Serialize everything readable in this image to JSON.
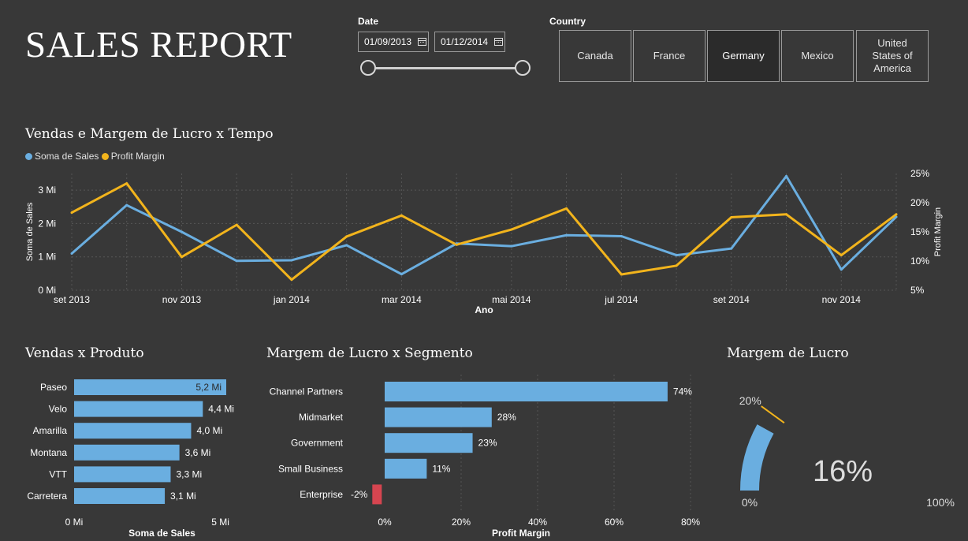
{
  "header": {
    "title": "SALES REPORT"
  },
  "date_filter": {
    "label": "Date",
    "start": "01/09/2013",
    "end": "01/12/2014",
    "range_fraction": [
      0,
      1
    ]
  },
  "country_filter": {
    "label": "Country",
    "options": [
      "Canada",
      "France",
      "Germany",
      "Mexico",
      "United States of America"
    ],
    "selected": "Germany"
  },
  "colors": {
    "background": "#383838",
    "sales": "#6aaee0",
    "margin": "#f2b41c",
    "negative": "#d64550",
    "grid": "#555555"
  },
  "chart_data": [
    {
      "type": "line",
      "title": "Vendas e Margem de Lucro x Tempo",
      "xlabel": "Ano",
      "ylabel": "Soma de Sales",
      "y2label": "Profit Margin",
      "legend": [
        "Soma de  Sales",
        "Profit Margin"
      ],
      "legend_position": "top-left",
      "x": [
        "set 2013",
        "out 2013",
        "nov 2013",
        "dez 2013",
        "jan 2014",
        "fev 2014",
        "mar 2014",
        "abr 2014",
        "mai 2014",
        "jun 2014",
        "jul 2014",
        "ago 2014",
        "set 2014",
        "out 2014",
        "nov 2014",
        "dez 2014"
      ],
      "x_ticks": [
        "set 2013",
        "nov 2013",
        "jan 2014",
        "mar 2014",
        "mai 2014",
        "jul 2014",
        "set 2014",
        "nov 2014"
      ],
      "y_ticks": [
        "0 Mi",
        "1 Mi",
        "2 Mi",
        "3 Mi"
      ],
      "y2_ticks": [
        "5%",
        "10%",
        "15%",
        "20%",
        "25%"
      ],
      "ylim": [
        0,
        3.5
      ],
      "y2lim": [
        5,
        25
      ],
      "series": [
        {
          "name": "Soma de  Sales",
          "axis": "left",
          "values": [
            1.1,
            2.55,
            1.75,
            0.88,
            0.9,
            1.35,
            0.48,
            1.4,
            1.32,
            1.65,
            1.62,
            1.05,
            1.25,
            3.42,
            0.62,
            2.2
          ]
        },
        {
          "name": "Profit Margin",
          "axis": "right",
          "values": [
            18.3,
            23.3,
            10.7,
            16.2,
            6.8,
            14.2,
            17.8,
            12.8,
            15.4,
            19.0,
            7.7,
            9.2,
            17.5,
            18.0,
            11.0,
            18.0
          ]
        }
      ]
    },
    {
      "type": "bar",
      "orientation": "horizontal",
      "title": "Vendas x Produto",
      "xlabel": "Soma de Sales",
      "categories": [
        "Paseo",
        "Velo",
        "Amarilla",
        "Montana",
        "VTT",
        "Carretera"
      ],
      "values": [
        5.2,
        4.4,
        4.0,
        3.6,
        3.3,
        3.1
      ],
      "value_labels": [
        "5,2 Mi",
        "4,4 Mi",
        "4,0 Mi",
        "3,6 Mi",
        "3,3 Mi",
        "3,1 Mi"
      ],
      "x_ticks": [
        "0 Mi",
        "5 Mi"
      ],
      "xlim": [
        0,
        5.2
      ]
    },
    {
      "type": "bar",
      "orientation": "horizontal",
      "title": "Margem de Lucro x Segmento",
      "xlabel": "Profit Margin",
      "categories": [
        "Channel Partners",
        "Midmarket",
        "Government",
        "Small Business",
        "Enterprise"
      ],
      "values": [
        74,
        28,
        23,
        11,
        -2
      ],
      "value_labels": [
        "74%",
        "28%",
        "23%",
        "11%",
        "-2%"
      ],
      "x_ticks": [
        "0%",
        "20%",
        "40%",
        "60%",
        "80%"
      ],
      "xlim": [
        0,
        80
      ]
    },
    {
      "type": "gauge",
      "title": "Margem de Lucro",
      "value": 16,
      "value_label": "16%",
      "min_label": "0%",
      "max_label": "100%",
      "target": 20,
      "target_label": "20%"
    }
  ]
}
